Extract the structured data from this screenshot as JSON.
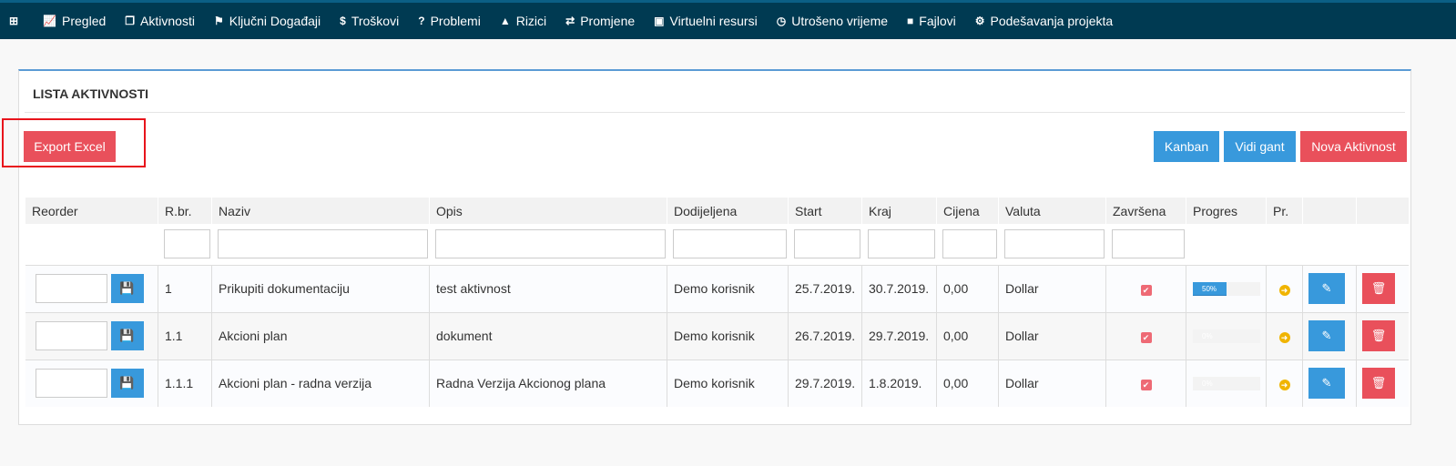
{
  "nav": [
    {
      "icon": "plus-square-icon",
      "glyph": "⊞",
      "label": ""
    },
    {
      "icon": "line-chart-icon",
      "glyph": "📈",
      "label": "Pregled"
    },
    {
      "icon": "files-icon",
      "glyph": "❐",
      "label": "Aktivnosti"
    },
    {
      "icon": "flag-icon",
      "glyph": "⚑",
      "label": "Ključni Događaji"
    },
    {
      "icon": "dollar-icon",
      "glyph": "$",
      "label": "Troškovi"
    },
    {
      "icon": "question-circle-icon",
      "glyph": "?",
      "label": "Problemi"
    },
    {
      "icon": "warning-icon",
      "glyph": "▲",
      "label": "Rizici"
    },
    {
      "icon": "exchange-icon",
      "glyph": "⇄",
      "label": "Promjene"
    },
    {
      "icon": "briefcase-icon",
      "glyph": "▣",
      "label": "Virtuelni resursi"
    },
    {
      "icon": "clock-icon",
      "glyph": "◷",
      "label": "Utrošeno vrijeme"
    },
    {
      "icon": "folder-icon",
      "glyph": "■",
      "label": "Fajlovi"
    },
    {
      "icon": "cogs-icon",
      "glyph": "⚙",
      "label": "Podešavanja projekta"
    }
  ],
  "panel": {
    "title": "LISTA AKTIVNOSTI",
    "export": "Export Excel",
    "kanban": "Kanban",
    "gant": "Vidi gant",
    "nova": "Nova Aktivnost"
  },
  "colors": {
    "nav": "#003a52",
    "blue": "#3899dc",
    "red": "#e9505b",
    "highlight": "#e8141c"
  },
  "columns": [
    "Reorder",
    "R.br.",
    "Naziv",
    "Opis",
    "Dodijeljena",
    "Start",
    "Kraj",
    "Cijena",
    "Valuta",
    "Završena",
    "Progres",
    "Pr.",
    "",
    ""
  ],
  "rows": [
    {
      "rbr": "1",
      "naziv": "Prikupiti dokumentaciju",
      "opis": "test aktivnost",
      "dodijeljena": "Demo korisnik",
      "start": "25.7.2019.",
      "kraj": "30.7.2019.",
      "cijena": "0,00",
      "valuta": "Dollar",
      "zavrsena": true,
      "progres": 50,
      "progres_label": "50%"
    },
    {
      "rbr": "1.1",
      "naziv": "Akcioni plan",
      "opis": "dokument",
      "dodijeljena": "Demo korisnik",
      "start": "26.7.2019.",
      "kraj": "29.7.2019.",
      "cijena": "0,00",
      "valuta": "Dollar",
      "zavrsena": true,
      "progres": 0,
      "progres_label": "0%"
    },
    {
      "rbr": "1.1.1",
      "naziv": "Akcioni plan - radna verzija",
      "opis": "Radna Verzija Akcionog plana",
      "dodijeljena": "Demo korisnik",
      "start": "29.7.2019.",
      "kraj": "1.8.2019.",
      "cijena": "0,00",
      "valuta": "Dollar",
      "zavrsena": true,
      "progres": 0,
      "progres_label": "0%"
    }
  ]
}
